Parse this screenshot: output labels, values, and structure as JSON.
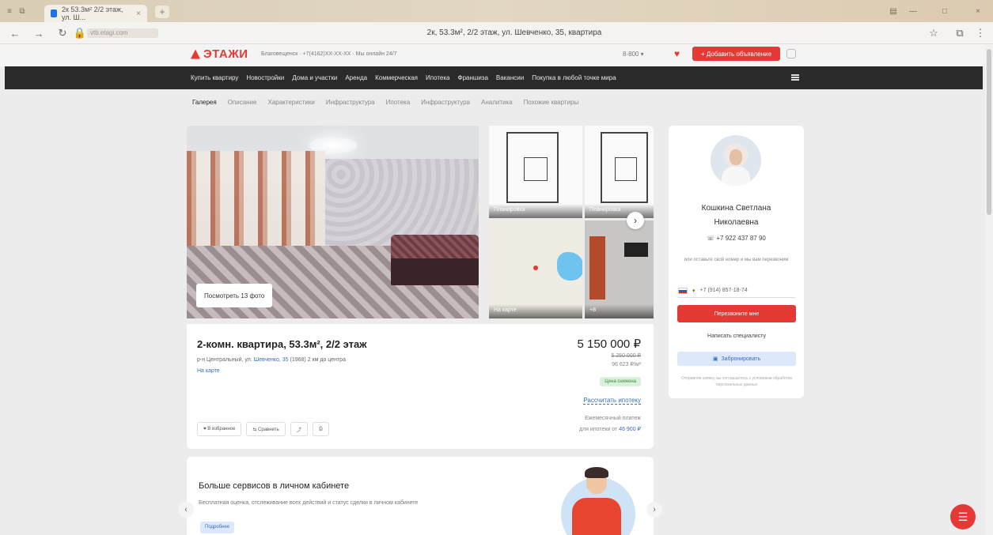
{
  "browser": {
    "tab_title": "2к 53.3м² 2/2 этаж, ул. Ш...",
    "new_tab_glyph": "+",
    "page_title": "2к, 53.3м², 2/2 этаж, ул. Шевченко, 35, квартира",
    "url_host": "vtb.etagi.com",
    "nav": {
      "back": "←",
      "forward": "→",
      "reload": "↻"
    },
    "window_controls": [
      "—",
      "□",
      "×"
    ],
    "toolbar_icons": [
      "☆",
      "⧉",
      "⋮"
    ]
  },
  "header": {
    "logo": "ЭТАЖИ",
    "city": "Благовещенск · +7(4162)XX-XX-XX · Мы онлайн 24/7",
    "phone_select": "8-800 ▾",
    "add_listing": "+ Добавить объявление"
  },
  "main_nav": [
    "Купить квартиру",
    "Новостройки",
    "Дома и участки",
    "Аренда",
    "Коммерческая",
    "Ипотека",
    "Франшиза",
    "Вакансии",
    "Покупка в любой точке мира"
  ],
  "subnav": {
    "active": "Галерея",
    "items": [
      "Описание",
      "Характеристики",
      "Инфраструктура",
      "Ипотека",
      "Инфраструктура",
      "Аналитика",
      "Похожие квартиры"
    ]
  },
  "gallery": {
    "photo_count": "Посмотреть 13 фото",
    "thumbs": [
      "Планировка",
      "Планировка",
      "На карте",
      "+8"
    ],
    "next": "›"
  },
  "listing": {
    "title": "2-комн. квартира, 53.3м², 2/2 этаж",
    "address_prefix": "р-н Центральный, ул.",
    "address_link": "Шевченко, 35",
    "address_suffix": "(1968) 2 км до центра",
    "on_map": "На карте",
    "price": "5 150 000 ₽",
    "old_price": "5 250 000 ₽",
    "per_m2": "96 623 ₽/м²",
    "badge": "Цена снижена",
    "mortgage_link": "Рассчитать ипотеку",
    "mortgage_note_1": "Ежемесячный платеж",
    "mortgage_note_2": "для ипотеки от",
    "mortgage_amount": "46 900 ₽",
    "actions": {
      "favorite": "♥ В избранное",
      "compare": "⇆ Сравнить",
      "share": "⤴",
      "print": "⎙"
    }
  },
  "promo": {
    "title": "Больше сервисов в личном кабинете",
    "text": "Бесплатная оценка, отслеживание всех действий и статус сделки в личном кабинете",
    "button": "Подробнее",
    "prev": "‹",
    "next": "›"
  },
  "agent": {
    "name_1": "Кошкина Светлана",
    "name_2": "Николаевна",
    "phone": "☏ +7 922 437 87 90",
    "note": "или оставьте свой номер и мы вам перезвоним",
    "phone_input": "+7 (914) 857-18-74",
    "call_button": "Перезвоните мне",
    "message_button": "Написать специалисту",
    "book_button": "Забронировать",
    "legal": "Отправляя заявку, вы соглашаетесь с условиями обработки персональных данных"
  },
  "fab": "☰",
  "colors": {
    "brand_red": "#e53935",
    "nav_dark": "#2a2a2a",
    "link_blue": "#3a6fb7"
  }
}
